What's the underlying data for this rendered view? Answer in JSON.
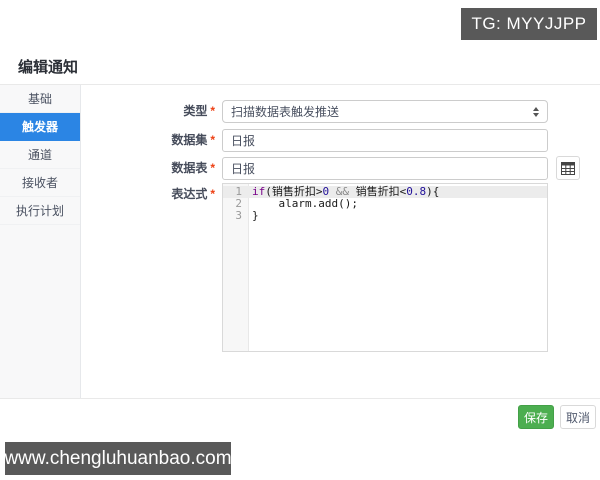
{
  "watermarks": {
    "top_right": "TG: MYYJJPP",
    "bottom_left": "www.chengluhuanbao.com"
  },
  "page": {
    "title": "编辑通知"
  },
  "sidebar": {
    "items": [
      {
        "key": "basic",
        "label": "基础",
        "active": false
      },
      {
        "key": "trigger",
        "label": "触发器",
        "active": true
      },
      {
        "key": "channel",
        "label": "通道",
        "active": false
      },
      {
        "key": "receiver",
        "label": "接收者",
        "active": false
      },
      {
        "key": "schedule",
        "label": "执行计划",
        "active": false
      }
    ]
  },
  "form": {
    "required_marker": "*",
    "type": {
      "label": "类型",
      "value": "扫描数据表触发推送"
    },
    "dataset": {
      "label": "数据集",
      "value": "日报"
    },
    "datatable": {
      "label": "数据表",
      "value": "日报"
    },
    "expression": {
      "label": "表达式"
    },
    "code": {
      "lines": [
        {
          "no": "1",
          "active": true,
          "tokens": [
            {
              "t": "if",
              "c": "keyword"
            },
            {
              "t": "(销售折扣>",
              "c": "plain"
            },
            {
              "t": "0",
              "c": "number"
            },
            {
              "t": " ",
              "c": "plain"
            },
            {
              "t": "&&",
              "c": "operator"
            },
            {
              "t": " 销售折扣<",
              "c": "plain"
            },
            {
              "t": "0.8",
              "c": "number"
            },
            {
              "t": "){",
              "c": "plain"
            }
          ]
        },
        {
          "no": "2",
          "active": false,
          "tokens": [
            {
              "t": "    alarm.add();",
              "c": "plain"
            }
          ]
        },
        {
          "no": "3",
          "active": false,
          "tokens": [
            {
              "t": "}",
              "c": "plain"
            }
          ]
        }
      ]
    }
  },
  "footer": {
    "save_label": "保存",
    "cancel_label": "取消"
  },
  "colors": {
    "accent_blue": "#2b85e4",
    "save_green": "#4cae50",
    "asterisk_red": "#ed4014",
    "watermark_bg": "#595959",
    "code_keyword": "#770088",
    "code_number": "#221199",
    "code_operator": "#888888"
  }
}
